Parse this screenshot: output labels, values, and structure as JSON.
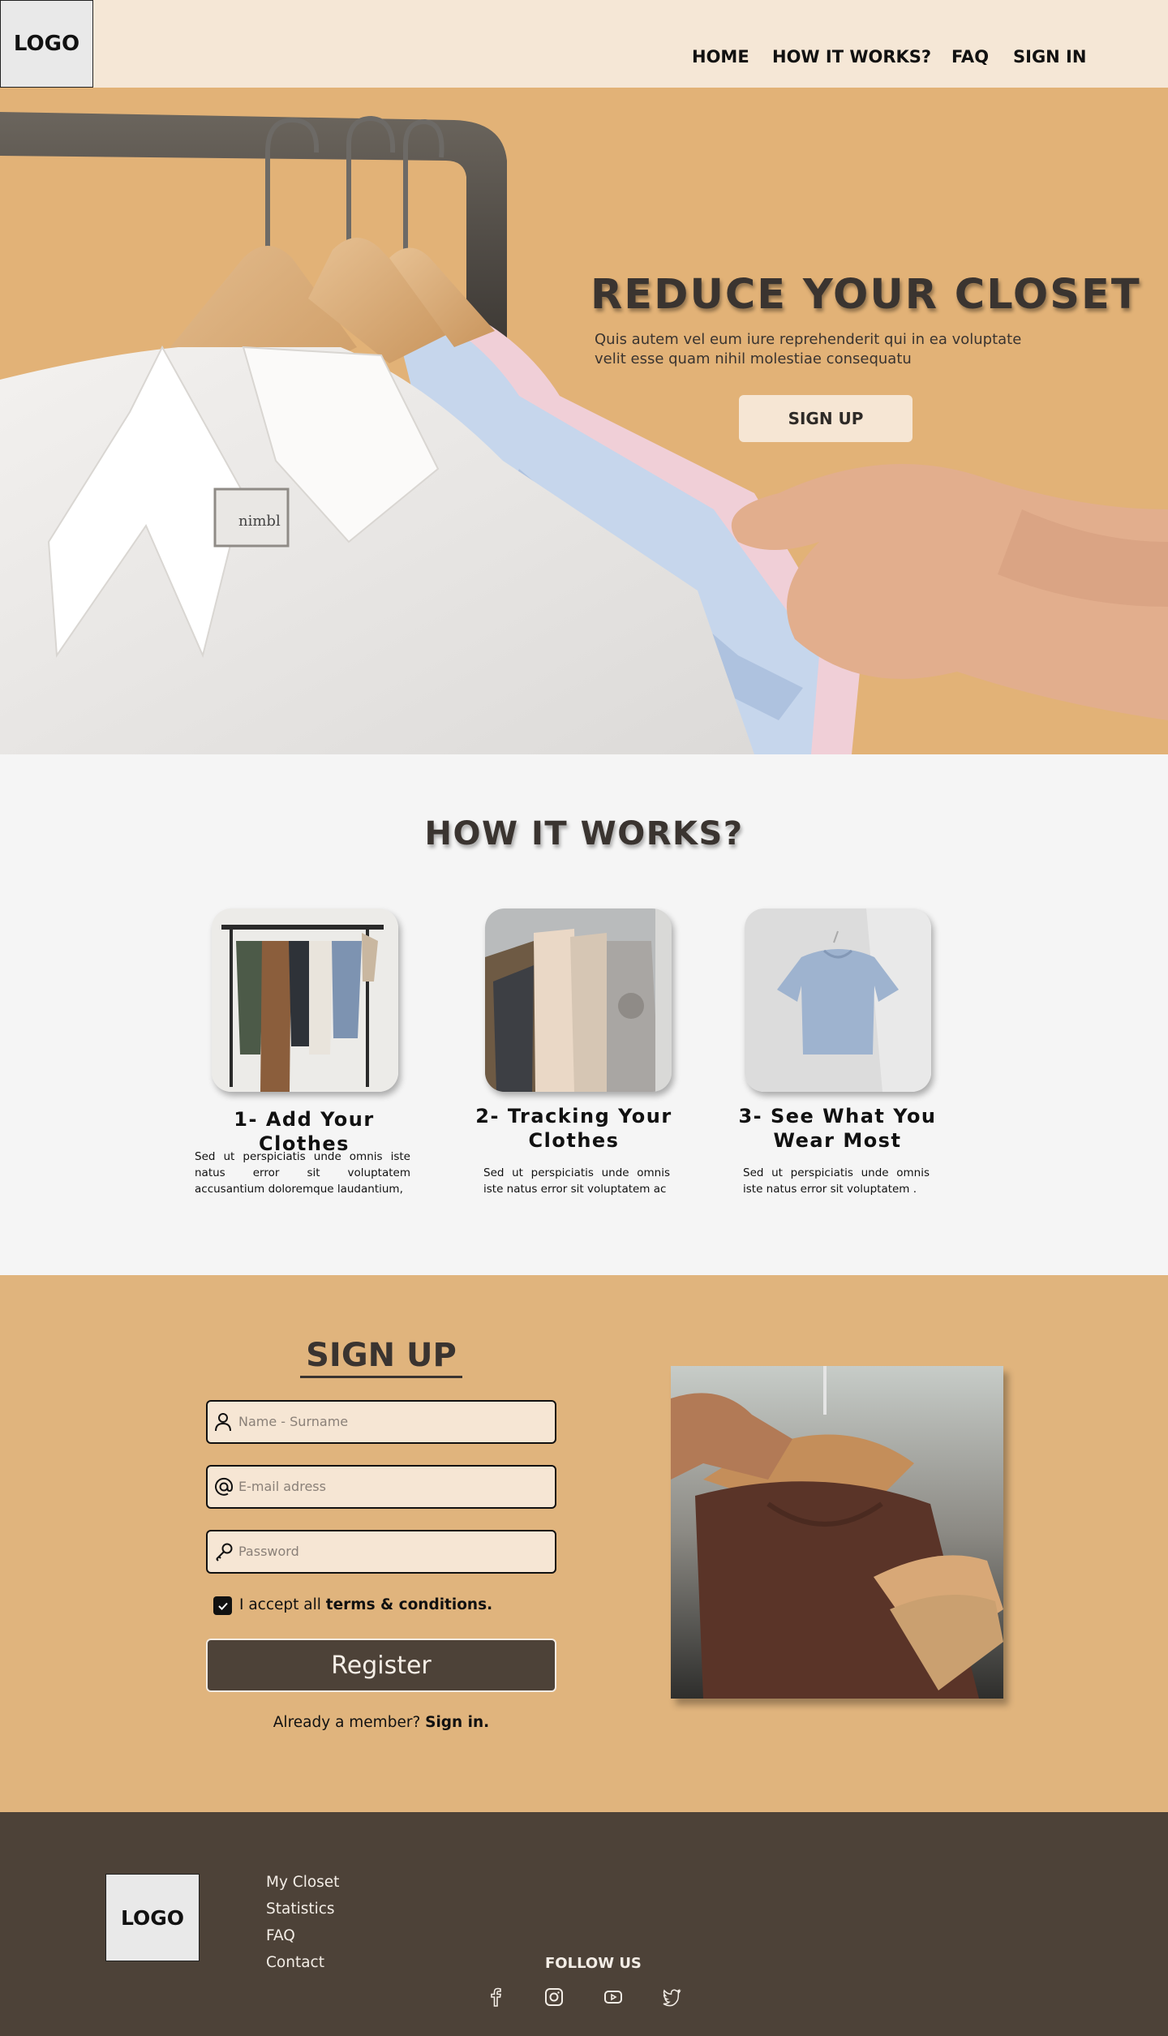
{
  "header": {
    "logo": "LOGO",
    "nav": [
      "HOME",
      "HOW IT WORKS?",
      "FAQ",
      "SIGN IN"
    ]
  },
  "hero": {
    "title": "REDUCE YOUR CLOSET",
    "text": "Quis autem vel eum iure reprehenderit qui in ea voluptate velit esse quam nihil molestiae consequatu",
    "button": "SIGN UP"
  },
  "how": {
    "title": "HOW IT WORKS?",
    "steps": [
      {
        "title": "1- Add Your Clothes",
        "text": "Sed ut perspiciatis unde omnis iste natus error sit voluptatem accusantium doloremque laudantium,"
      },
      {
        "title": "2- Tracking Your Clothes",
        "text": "Sed ut perspiciatis unde omnis iste natus error sit voluptatem ac"
      },
      {
        "title": "3- See What You Wear Most",
        "text": "Sed ut perspiciatis unde omnis iste natus error sit voluptatem ."
      }
    ]
  },
  "signup": {
    "title": "SIGN UP",
    "name_placeholder": "Name - Surname",
    "email_placeholder": "E-mail adress",
    "password_placeholder": "Password",
    "terms_prefix": "I accept all ",
    "terms_link": "terms & conditions.",
    "register": "Register",
    "already": "Already a member? ",
    "signin_link": "Sign in."
  },
  "footer": {
    "logo": "LOGO",
    "links": [
      "My Closet",
      "Statistics",
      "FAQ",
      "Contact"
    ],
    "follow": "FOLLOW US",
    "socials": [
      "facebook-icon",
      "instagram-icon",
      "youtube-icon",
      "twitter-icon"
    ]
  },
  "colors": {
    "header_bg": "#f5e7d6",
    "hero_bg": "#e2b277",
    "signup_bg": "#e0b47d",
    "footer_bg": "#4d4238",
    "dark_text": "#3a3430"
  }
}
